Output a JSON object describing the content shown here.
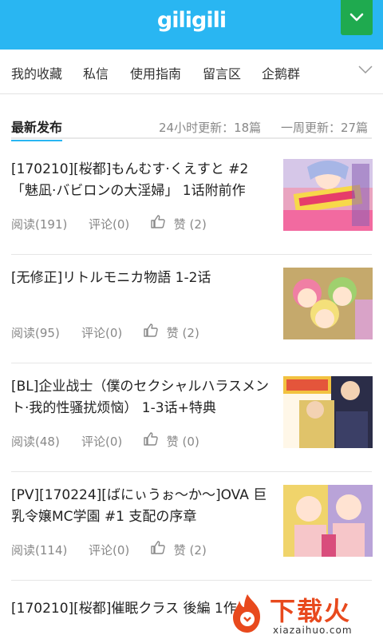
{
  "header": {
    "logo": "giligili",
    "menu_icon": "chevron-down-icon"
  },
  "nav": {
    "items": [
      "我的收藏",
      "私信",
      "使用指南",
      "留言区",
      "企鹅群"
    ],
    "more_icon": "chevron-down-icon"
  },
  "tabs": {
    "active": "最新发布",
    "stat_24h": "24小时更新：18篇",
    "stat_week": "一周更新：27篇"
  },
  "posts": [
    {
      "title": "[170210][桜都]もんむす·くえすと #2「魅凪·バビロンの大淫婦」 1话附前作",
      "read": "阅读(191)",
      "comment": "评论(0)",
      "like": "赞 (2)"
    },
    {
      "title": "[无修正]リトルモニカ物語 1-2话",
      "read": "阅读(95)",
      "comment": "评论(0)",
      "like": "赞 (2)"
    },
    {
      "title": "[BL]企业战士（僕のセクシャルハラスメント·我的性骚扰烦恼） 1-3话+特典",
      "read": "阅读(48)",
      "comment": "评论(0)",
      "like": "赞 (0)"
    },
    {
      "title": "[PV][170224][ばにぃうぉ〜か〜]OVA 巨乳令嬢MC学園 #1 支配の序章",
      "read": "阅读(114)",
      "comment": "评论(0)",
      "like": "赞 (2)"
    }
  ],
  "last_post": {
    "title": "[170210][桜都]催眠クラス 後編 1作"
  },
  "watermark": {
    "text": "下载火",
    "url": "xiazaihuo.com"
  },
  "colors": {
    "header": "#29b6f2",
    "menu_button": "#1faa4f",
    "accent": "#29b6f2",
    "watermark": "#e8491d"
  }
}
